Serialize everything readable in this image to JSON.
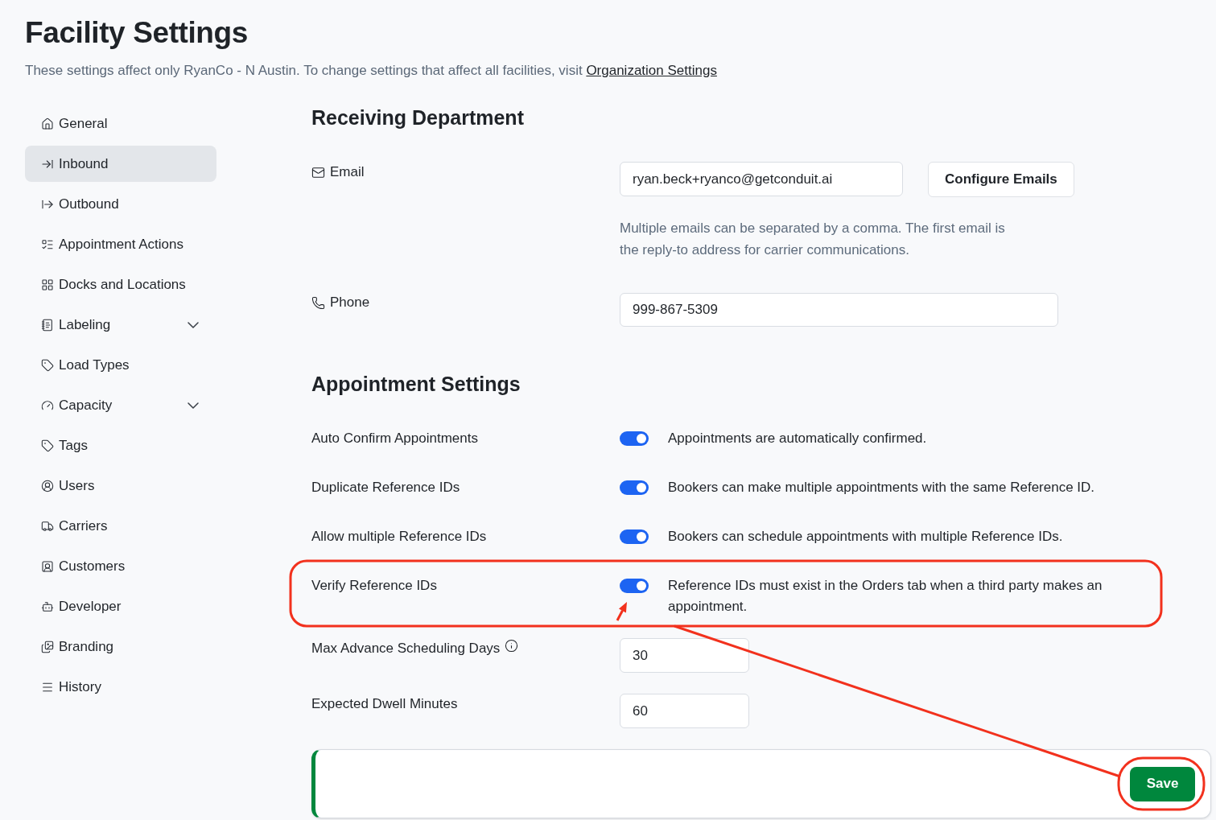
{
  "header": {
    "title": "Facility Settings",
    "subtitle": "These settings affect only RyanCo - N Austin. To change settings that affect all facilities, visit",
    "link": "Organization Settings"
  },
  "sidebar": {
    "items": [
      {
        "label": "General",
        "selected": false,
        "submenu": false
      },
      {
        "label": "Inbound",
        "selected": true,
        "submenu": false
      },
      {
        "label": "Outbound",
        "selected": false,
        "submenu": false
      },
      {
        "label": "Appointment Actions",
        "selected": false,
        "submenu": false
      },
      {
        "label": "Docks and Locations",
        "selected": false,
        "submenu": false
      },
      {
        "label": "Labeling",
        "selected": false,
        "submenu": true
      },
      {
        "label": "Load Types",
        "selected": false,
        "submenu": false
      },
      {
        "label": "Capacity",
        "selected": false,
        "submenu": true
      },
      {
        "label": "Tags",
        "selected": false,
        "submenu": false
      },
      {
        "label": "Users",
        "selected": false,
        "submenu": false
      },
      {
        "label": "Carriers",
        "selected": false,
        "submenu": false
      },
      {
        "label": "Customers",
        "selected": false,
        "submenu": false
      },
      {
        "label": "Developer",
        "selected": false,
        "submenu": false
      },
      {
        "label": "Branding",
        "selected": false,
        "submenu": false
      },
      {
        "label": "History",
        "selected": false,
        "submenu": false
      }
    ]
  },
  "receiving_department": {
    "heading": "Receiving Department",
    "email": {
      "label": "Email",
      "value": "ryan.beck+ryanco@getconduit.ai",
      "button": "Configure Emails",
      "help": "Multiple emails can be separated by a comma. The first email is the reply-to address for carrier communications."
    },
    "phone": {
      "label": "Phone",
      "value": "999-867-5309"
    }
  },
  "appointment_settings": {
    "heading": "Appointment Settings",
    "toggles": [
      {
        "label": "Auto Confirm Appointments",
        "on": true,
        "description": "Appointments are automatically confirmed."
      },
      {
        "label": "Duplicate Reference IDs",
        "on": true,
        "description": "Bookers can make multiple appointments with the same Reference ID."
      },
      {
        "label": "Allow multiple Reference IDs",
        "on": true,
        "description": "Bookers can schedule appointments with multiple Reference IDs."
      },
      {
        "label": "Verify Reference IDs",
        "on": true,
        "description": "Reference IDs must exist in the Orders tab when a third party makes an appointment."
      }
    ],
    "number_fields": [
      {
        "label": "Max Advance Scheduling Days",
        "info": true,
        "value": "30"
      },
      {
        "label": "Expected Dwell Minutes",
        "info": false,
        "value": "60"
      }
    ]
  },
  "save_bar": {
    "button": "Save"
  },
  "annotations": [
    {
      "kind": "outline"
    },
    {
      "kind": "arrow"
    },
    {
      "kind": "line"
    },
    {
      "kind": "ring"
    }
  ]
}
